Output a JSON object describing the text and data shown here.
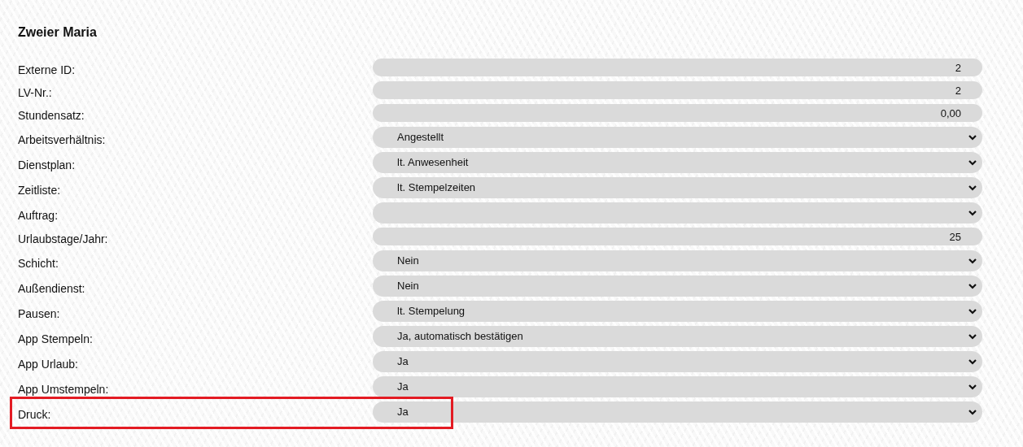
{
  "title": "Zweier Maria",
  "fields": [
    {
      "label": "Externe ID:",
      "kind": "input",
      "value": "2",
      "highlighted": false
    },
    {
      "label": "LV-Nr.:",
      "kind": "input",
      "value": "2",
      "highlighted": false
    },
    {
      "label": "Stundensatz:",
      "kind": "input",
      "value": "0,00",
      "highlighted": false
    },
    {
      "label": "Arbeitsverhältnis:",
      "kind": "select",
      "value": "Angestellt",
      "highlighted": false
    },
    {
      "label": "Dienstplan:",
      "kind": "select",
      "value": "lt. Anwesenheit",
      "highlighted": false
    },
    {
      "label": "Zeitliste:",
      "kind": "select",
      "value": "lt. Stempelzeiten",
      "highlighted": false
    },
    {
      "label": "Auftrag:",
      "kind": "select",
      "highlighted": false
    },
    {
      "label": "Urlaubstage/Jahr:",
      "kind": "input",
      "value": "25",
      "highlighted": false
    },
    {
      "label": "Schicht:",
      "kind": "select",
      "value": "Nein",
      "highlighted": false
    },
    {
      "label": "Außendienst:",
      "kind": "select",
      "value": "Nein",
      "highlighted": false
    },
    {
      "label": "Pausen:",
      "kind": "select",
      "value": "lt. Stempelung",
      "highlighted": false
    },
    {
      "label": "App Stempeln:",
      "kind": "select",
      "value": "Ja, automatisch bestätigen",
      "highlighted": false
    },
    {
      "label": "App Urlaub:",
      "kind": "select",
      "value": "Ja",
      "highlighted": false
    },
    {
      "label": "App Umstempeln:",
      "kind": "select",
      "value": "Ja",
      "highlighted": false
    },
    {
      "label": "Druck:",
      "kind": "select",
      "value": "Ja",
      "highlighted": true
    }
  ]
}
